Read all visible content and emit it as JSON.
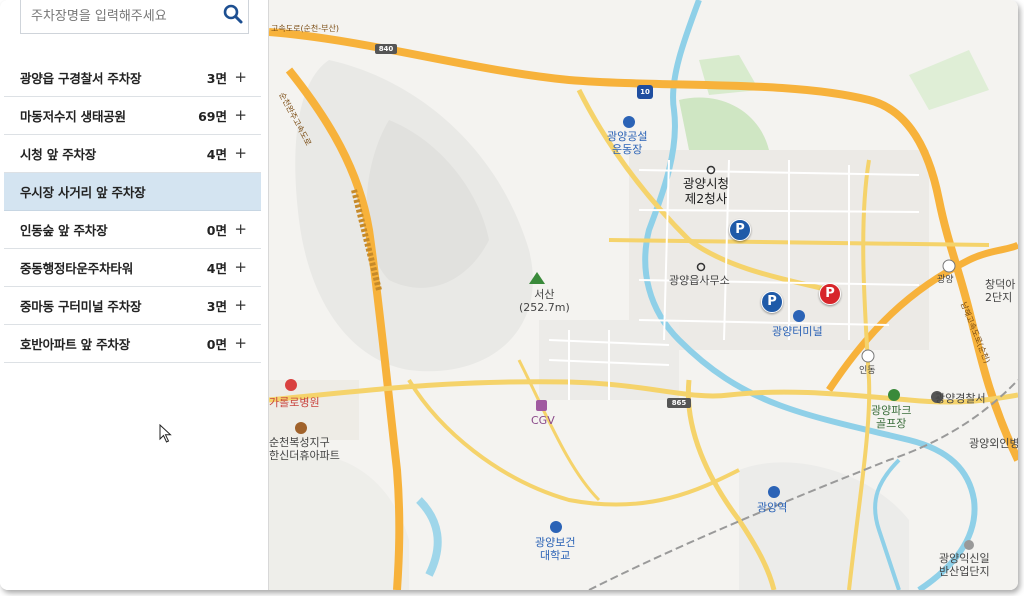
{
  "search": {
    "placeholder": "주차장명을 입력해주세요",
    "icon": "search-icon"
  },
  "parking_list": [
    {
      "name": "광양읍 구경찰서 주차장",
      "count": "3면",
      "action": "+"
    },
    {
      "name": "마동저수지 생태공원",
      "count": "69면",
      "action": "+"
    },
    {
      "name": "시청 앞 주차장",
      "count": "4면",
      "action": "+"
    },
    {
      "name": "우시장 사거리 앞 주차장",
      "count": "",
      "action": "",
      "selected": true
    },
    {
      "name": "인동숲 앞 주차장",
      "count": "0면",
      "action": "+"
    },
    {
      "name": "중동행정타운주차타워",
      "count": "4면",
      "action": "+"
    },
    {
      "name": "중마동 구터미널 주차장",
      "count": "3면",
      "action": "+"
    },
    {
      "name": "호반아파트 앞 주차장",
      "count": "0면",
      "action": "+"
    }
  ],
  "map": {
    "labels": {
      "expressway": "고속도로(순천-부산)",
      "expressway2": "순천완주고속도로",
      "expressway3": "남해고속도로(순천)",
      "road_840": "840",
      "road_10": "10",
      "road_865": "865",
      "stadium": "광양공설\n운동장",
      "city_hall": "광양시청\n제2청사",
      "town_office": "광양읍사무소",
      "terminal": "광양터미널",
      "mountain": "서산\n(252.7m)",
      "cgv": "CGV",
      "hospital": "가롤로병원",
      "apartment": "순천복성지구\n한신더휴아파트",
      "police": "광양경찰서",
      "golf": "광양파크\n골프장",
      "station": "광양역",
      "college": "광양보건\n대학교",
      "ic_gwangyang": "광양",
      "ic_indong": "인동",
      "changdeok": "창덕아\n2단지",
      "clinic": "광양외인병",
      "industrial": "광양익신일\n반산업단지"
    },
    "colors": {
      "highway": "#f7b23b",
      "road": "#f5d36b",
      "river": "#8fd0e8",
      "park": "#cfe6c3",
      "parking_blue": "#1f5aa8",
      "parking_red": "#d7262b"
    },
    "markers": [
      "parking-blue",
      "parking-blue",
      "parking-red"
    ],
    "marker_label": "P"
  }
}
